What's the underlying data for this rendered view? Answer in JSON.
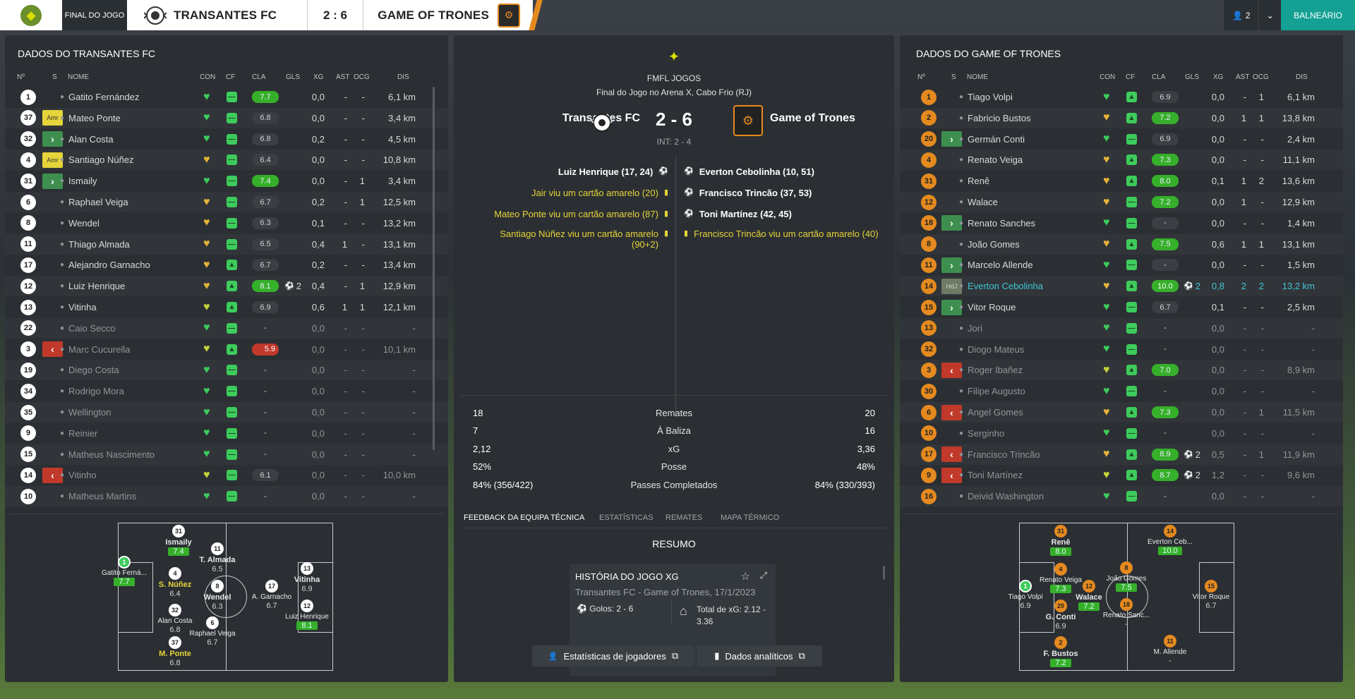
{
  "top": {
    "phase": "FINAL DO JOGO",
    "home": "TRANSANTES FC",
    "score": "2 : 6",
    "away": "GAME OF TRONES",
    "count": "2",
    "balneario": "BALNEÁRIO"
  },
  "headers": {
    "no": "Nº",
    "s": "S",
    "nome": "NOME",
    "con": "CON",
    "cf": "CF",
    "cla": "CLA",
    "gls": "GLS",
    "xg": "XG",
    "ast": "AST",
    "ocg": "OCG",
    "dis": "DIS"
  },
  "home": {
    "title": "DADOS DO TRANSANTES FC",
    "players": [
      {
        "no": "1",
        "s": "",
        "name": "Gatito Fernández",
        "con": "g",
        "cf": "-",
        "cla": "7.7",
        "clac": "g",
        "gls": "",
        "xg": "0,0",
        "ast": "-",
        "ocg": "-",
        "dis": "6,1 km",
        "dim": false
      },
      {
        "no": "37",
        "s": "Amr",
        "name": "Mateo Ponte",
        "con": "g",
        "cf": "-",
        "cla": "6.8",
        "clac": "n",
        "gls": "",
        "xg": "0,0",
        "ast": "-",
        "ocg": "-",
        "dis": "3,4 km",
        "dim": false
      },
      {
        "no": "32",
        "s": ">",
        "name": "Alan Costa",
        "con": "g",
        "cf": "-",
        "cla": "6.8",
        "clac": "n",
        "gls": "",
        "xg": "0,2",
        "ast": "-",
        "ocg": "-",
        "dis": "4,5 km",
        "dim": false
      },
      {
        "no": "4",
        "s": "Amr",
        "name": "Santiago Núñez",
        "con": "o",
        "cf": "-",
        "cla": "6.4",
        "clac": "n",
        "gls": "",
        "xg": "0,0",
        "ast": "-",
        "ocg": "-",
        "dis": "10,8 km",
        "dim": false
      },
      {
        "no": "31",
        "s": ">",
        "name": "Ismaily",
        "con": "g",
        "cf": "-",
        "cla": "7.4",
        "clac": "g",
        "gls": "",
        "xg": "0,0",
        "ast": "-",
        "ocg": "1",
        "dis": "3,4 km",
        "dim": false
      },
      {
        "no": "6",
        "s": "",
        "name": "Raphael Veiga",
        "con": "o",
        "cf": "-",
        "cla": "6.7",
        "clac": "n",
        "gls": "",
        "xg": "0,2",
        "ast": "-",
        "ocg": "1",
        "dis": "12,5 km",
        "dim": false
      },
      {
        "no": "8",
        "s": "",
        "name": "Wendel",
        "con": "o",
        "cf": "-",
        "cla": "6.3",
        "clac": "n",
        "gls": "",
        "xg": "0,1",
        "ast": "-",
        "ocg": "-",
        "dis": "13,2 km",
        "dim": false
      },
      {
        "no": "11",
        "s": "",
        "name": "Thiago Almada",
        "con": "o",
        "cf": "-",
        "cla": "6.5",
        "clac": "n",
        "gls": "",
        "xg": "0,4",
        "ast": "1",
        "ocg": "-",
        "dis": "13,1 km",
        "dim": false
      },
      {
        "no": "17",
        "s": "",
        "name": "Alejandro Garnacho",
        "con": "o",
        "cf": "+",
        "cla": "6.7",
        "clac": "n",
        "gls": "",
        "xg": "0,2",
        "ast": "-",
        "ocg": "-",
        "dis": "13,4 km",
        "dim": false
      },
      {
        "no": "12",
        "s": "",
        "name": "Luiz Henrique",
        "con": "o",
        "cf": "+",
        "cla": "8.1",
        "clac": "g",
        "gls": "2",
        "xg": "0,4",
        "ast": "-",
        "ocg": "1",
        "dis": "12,9 km",
        "dim": false
      },
      {
        "no": "13",
        "s": "",
        "name": "Vitinha",
        "con": "y",
        "cf": "+",
        "cla": "6.9",
        "clac": "n",
        "gls": "",
        "xg": "0,6",
        "ast": "1",
        "ocg": "1",
        "dis": "12,1 km",
        "dim": false
      },
      {
        "no": "22",
        "s": "",
        "name": "Caio Secco",
        "con": "g",
        "cf": "-",
        "cla": "-",
        "clac": "x",
        "gls": "",
        "xg": "0,0",
        "ast": "-",
        "ocg": "-",
        "dis": "-",
        "dim": true
      },
      {
        "no": "3",
        "s": "<",
        "name": "Marc Cucurella",
        "con": "y",
        "cf": "+",
        "cla": "5.9",
        "clac": "r",
        "gls": "",
        "xg": "0,0",
        "ast": "-",
        "ocg": "-",
        "dis": "10,1 km",
        "dim": true
      },
      {
        "no": "19",
        "s": "",
        "name": "Diego Costa",
        "con": "g",
        "cf": "-",
        "cla": "-",
        "clac": "x",
        "gls": "",
        "xg": "0,0",
        "ast": "-",
        "ocg": "-",
        "dis": "-",
        "dim": true
      },
      {
        "no": "34",
        "s": "",
        "name": "Rodrigo Mora",
        "con": "g",
        "cf": "-",
        "cla": "-",
        "clac": "x",
        "gls": "",
        "xg": "0,0",
        "ast": "-",
        "ocg": "-",
        "dis": "-",
        "dim": true
      },
      {
        "no": "35",
        "s": "",
        "name": "Wellington",
        "con": "g",
        "cf": "-",
        "cla": "-",
        "clac": "x",
        "gls": "",
        "xg": "0,0",
        "ast": "-",
        "ocg": "-",
        "dis": "-",
        "dim": true
      },
      {
        "no": "9",
        "s": "",
        "name": "Reinier",
        "con": "g",
        "cf": "-",
        "cla": "-",
        "clac": "x",
        "gls": "",
        "xg": "0,0",
        "ast": "-",
        "ocg": "-",
        "dis": "-",
        "dim": true
      },
      {
        "no": "15",
        "s": "",
        "name": "Matheus Nascimento",
        "con": "g",
        "cf": "-",
        "cla": "-",
        "clac": "x",
        "gls": "",
        "xg": "0,0",
        "ast": "-",
        "ocg": "-",
        "dis": "-",
        "dim": true
      },
      {
        "no": "14",
        "s": "<",
        "name": "Vitinho",
        "con": "y",
        "cf": "-",
        "cla": "6.1",
        "clac": "n",
        "gls": "",
        "xg": "0,0",
        "ast": "-",
        "ocg": "-",
        "dis": "10,0 km",
        "dim": true
      },
      {
        "no": "10",
        "s": "",
        "name": "Matheus Martins",
        "con": "g",
        "cf": "-",
        "cla": "-",
        "clac": "x",
        "gls": "",
        "xg": "0,0",
        "ast": "-",
        "ocg": "-",
        "dis": "-",
        "dim": true
      }
    ],
    "formation": [
      {
        "no": "1",
        "name": "Gatito Ferná...",
        "rating": "7.7",
        "g": true,
        "gk": true,
        "y": false,
        "b": false
      },
      {
        "no": "31",
        "name": "Ismaily",
        "rating": "7.4",
        "g": true,
        "gk": false,
        "y": false,
        "b": true
      },
      {
        "no": "4",
        "name": "S. Núñez",
        "rating": "6.4",
        "g": false,
        "gk": false,
        "y": true,
        "b": true
      },
      {
        "no": "32",
        "name": "Alan Costa",
        "rating": "6.8",
        "g": false,
        "gk": false,
        "y": false,
        "b": false
      },
      {
        "no": "37",
        "name": "M. Ponte",
        "rating": "6.8",
        "g": false,
        "gk": false,
        "y": true,
        "b": true
      },
      {
        "no": "11",
        "name": "T. Almada",
        "rating": "6.5",
        "g": false,
        "gk": false,
        "y": false,
        "b": true
      },
      {
        "no": "8",
        "name": "Wendel",
        "rating": "6.3",
        "g": false,
        "gk": false,
        "y": false,
        "b": true
      },
      {
        "no": "6",
        "name": "Raphael Veiga",
        "rating": "6.7",
        "g": false,
        "gk": false,
        "y": false,
        "b": false
      },
      {
        "no": "17",
        "name": "A. Garnacho",
        "rating": "6.7",
        "g": false,
        "gk": false,
        "y": false,
        "b": false
      },
      {
        "no": "13",
        "name": "Vitinha",
        "rating": "6.9",
        "g": false,
        "gk": false,
        "y": false,
        "b": true
      },
      {
        "no": "12",
        "name": "Luiz Henrique",
        "rating": "8.1",
        "g": true,
        "gk": false,
        "y": false,
        "b": false
      }
    ]
  },
  "away": {
    "title": "DADOS DO GAME OF TRONES",
    "players": [
      {
        "no": "1",
        "s": "",
        "name": "Tiago Volpi",
        "con": "g",
        "cf": "+",
        "cla": "6.9",
        "clac": "n",
        "gls": "",
        "xg": "0,0",
        "ast": "-",
        "ocg": "1",
        "dis": "6,1 km",
        "dim": false
      },
      {
        "no": "2",
        "s": "",
        "name": "Fabricio Bustos",
        "con": "o",
        "cf": "+",
        "cla": "7.2",
        "clac": "g",
        "gls": "",
        "xg": "0,0",
        "ast": "1",
        "ocg": "1",
        "dis": "13,8 km",
        "dim": false
      },
      {
        "no": "20",
        "s": ">",
        "name": "Germán Conti",
        "con": "g",
        "cf": "-",
        "cla": "6.9",
        "clac": "n",
        "gls": "",
        "xg": "0,0",
        "ast": "-",
        "ocg": "-",
        "dis": "2,4 km",
        "dim": false
      },
      {
        "no": "4",
        "s": "",
        "name": "Renato Veiga",
        "con": "o",
        "cf": "+",
        "cla": "7.3",
        "clac": "g",
        "gls": "",
        "xg": "0,0",
        "ast": "-",
        "ocg": "-",
        "dis": "11,1 km",
        "dim": false
      },
      {
        "no": "31",
        "s": "",
        "name": "Renê",
        "con": "o",
        "cf": "+",
        "cla": "8.0",
        "clac": "g",
        "gls": "",
        "xg": "0,1",
        "ast": "1",
        "ocg": "2",
        "dis": "13,6 km",
        "dim": false
      },
      {
        "no": "12",
        "s": "",
        "name": "Walace",
        "con": "o",
        "cf": "-",
        "cla": "7.2",
        "clac": "g",
        "gls": "",
        "xg": "0,0",
        "ast": "1",
        "ocg": "-",
        "dis": "12,9 km",
        "dim": false
      },
      {
        "no": "18",
        "s": ">",
        "name": "Renato Sanches",
        "con": "g",
        "cf": "-",
        "cla": "-",
        "clac": "n",
        "gls": "",
        "xg": "0,0",
        "ast": "-",
        "ocg": "-",
        "dis": "1,4 km",
        "dim": false
      },
      {
        "no": "8",
        "s": "",
        "name": "João Gomes",
        "con": "o",
        "cf": "+",
        "cla": "7.5",
        "clac": "g",
        "gls": "",
        "xg": "0,6",
        "ast": "1",
        "ocg": "1",
        "dis": "13,1 km",
        "dim": false
      },
      {
        "no": "11",
        "s": ">",
        "name": "Marcelo Allende",
        "con": "g",
        "cf": "-",
        "cla": "-",
        "clac": "n",
        "gls": "",
        "xg": "0,0",
        "ast": "-",
        "ocg": "-",
        "dis": "1,5 km",
        "dim": false
      },
      {
        "no": "14",
        "s": "HdJ",
        "name": "Everton Cebolinha",
        "con": "o",
        "cf": "+",
        "cla": "10.0",
        "clac": "g",
        "gls": "2",
        "xg": "0,8",
        "ast": "2",
        "ocg": "2",
        "dis": "13,2 km",
        "dim": false,
        "hl": true
      },
      {
        "no": "15",
        "s": ">",
        "name": "Vitor Roque",
        "con": "g",
        "cf": "-",
        "cla": "6.7",
        "clac": "n",
        "gls": "",
        "xg": "0,1",
        "ast": "-",
        "ocg": "-",
        "dis": "2,5 km",
        "dim": false
      },
      {
        "no": "13",
        "s": "",
        "name": "Jori",
        "con": "g",
        "cf": "-",
        "cla": "-",
        "clac": "x",
        "gls": "",
        "xg": "0,0",
        "ast": "-",
        "ocg": "-",
        "dis": "-",
        "dim": true
      },
      {
        "no": "32",
        "s": "",
        "name": "Diogo Mateus",
        "con": "g",
        "cf": "-",
        "cla": "-",
        "clac": "x",
        "gls": "",
        "xg": "0,0",
        "ast": "-",
        "ocg": "-",
        "dis": "-",
        "dim": true
      },
      {
        "no": "3",
        "s": "<",
        "name": "Roger Ibañez",
        "con": "y",
        "cf": "+",
        "cla": "7.0",
        "clac": "g",
        "gls": "",
        "xg": "0,0",
        "ast": "-",
        "ocg": "-",
        "dis": "8,9 km",
        "dim": true
      },
      {
        "no": "30",
        "s": "",
        "name": "Filipe Augusto",
        "con": "g",
        "cf": "-",
        "cla": "-",
        "clac": "x",
        "gls": "",
        "xg": "0,0",
        "ast": "-",
        "ocg": "-",
        "dis": "-",
        "dim": true
      },
      {
        "no": "6",
        "s": "<",
        "name": "Angel Gomes",
        "con": "o",
        "cf": "+",
        "cla": "7.3",
        "clac": "g",
        "gls": "",
        "xg": "0,0",
        "ast": "-",
        "ocg": "1",
        "dis": "11,5 km",
        "dim": true
      },
      {
        "no": "10",
        "s": "",
        "name": "Serginho",
        "con": "g",
        "cf": "-",
        "cla": "-",
        "clac": "x",
        "gls": "",
        "xg": "0,0",
        "ast": "-",
        "ocg": "-",
        "dis": "-",
        "dim": true
      },
      {
        "no": "17",
        "s": "<",
        "name": "Francisco Trincão",
        "con": "o",
        "cf": "+",
        "cla": "8.9",
        "clac": "g",
        "gls": "2",
        "xg": "0,5",
        "ast": "-",
        "ocg": "1",
        "dis": "11,9 km",
        "dim": true
      },
      {
        "no": "9",
        "s": "<",
        "name": "Toni Martínez",
        "con": "y",
        "cf": "+",
        "cla": "8.7",
        "clac": "g",
        "gls": "2",
        "xg": "1,2",
        "ast": "-",
        "ocg": "-",
        "dis": "9,6 km",
        "dim": true
      },
      {
        "no": "16",
        "s": "",
        "name": "Deivid Washington",
        "con": "g",
        "cf": "-",
        "cla": "-",
        "clac": "x",
        "gls": "",
        "xg": "0,0",
        "ast": "-",
        "ocg": "-",
        "dis": "-",
        "dim": true
      }
    ],
    "formation": [
      {
        "no": "1",
        "name": "Tiago Volpi",
        "rating": "6.9",
        "g": false,
        "gk": true
      },
      {
        "no": "31",
        "name": "Renê",
        "rating": "8.0",
        "g": true,
        "gk": false,
        "b": true
      },
      {
        "no": "4",
        "name": "Renato Veiga",
        "rating": "7.3",
        "g": true,
        "gk": false
      },
      {
        "no": "20",
        "name": "G. Conti",
        "rating": "6.9",
        "g": false,
        "gk": false,
        "b": true
      },
      {
        "no": "2",
        "name": "F. Bustos",
        "rating": "7.2",
        "g": true,
        "gk": false,
        "b": true
      },
      {
        "no": "12",
        "name": "Walace",
        "rating": "7.2",
        "g": true,
        "gk": false,
        "b": true
      },
      {
        "no": "8",
        "name": "João Gomes",
        "rating": "7.5",
        "g": true,
        "gk": false
      },
      {
        "no": "18",
        "name": "Renato Sanc...",
        "rating": "-",
        "g": false,
        "gk": false
      },
      {
        "no": "14",
        "name": "Everton Ceb...",
        "rating": "10.0",
        "g": true,
        "gk": false
      },
      {
        "no": "15",
        "name": "Vitor Roque",
        "rating": "6.7",
        "g": false,
        "gk": false
      },
      {
        "no": "11",
        "name": "M. Allende",
        "rating": "-",
        "g": false,
        "gk": false
      }
    ]
  },
  "center": {
    "competition": "FMFL JOGOS",
    "venue": "Final do Jogo no Arena X, Cabo Frio (RJ)",
    "home": "Transantes FC",
    "away": "Game of Trones",
    "score": "2 - 6",
    "ht": "INT: 2 - 4",
    "home_events": [
      {
        "text": "Luiz Henrique (17, 24)",
        "type": "goal"
      },
      {
        "text": "Jair viu um cartão amarelo (20)",
        "type": "card"
      },
      {
        "text": "Mateo Ponte viu um cartão amarelo (87)",
        "type": "card"
      },
      {
        "text": "Santiago Núñez viu um cartão amarelo (90+2)",
        "type": "card"
      }
    ],
    "away_events": [
      {
        "text": "Everton Cebolinha (10, 51)",
        "type": "goal"
      },
      {
        "text": "Francisco Trincão (37, 53)",
        "type": "goal"
      },
      {
        "text": "Toni Martínez (42, 45)",
        "type": "goal"
      },
      {
        "text": "Francisco Trincão viu um cartão amarelo (40)",
        "type": "card"
      }
    ],
    "stats": [
      {
        "home": "18",
        "label": "Remates",
        "away": "20"
      },
      {
        "home": "7",
        "label": "À Baliza",
        "away": "16"
      },
      {
        "home": "2,12",
        "label": "xG",
        "away": "3,36"
      },
      {
        "home": "52%",
        "label": "Posse",
        "away": "48%"
      },
      {
        "home": "84% (356/422)",
        "label": "Passes Completados",
        "away": "84% (330/393)"
      }
    ],
    "tabs": [
      "FEEDBACK DA EQUIPA TÉCNICA",
      "ESTATÍSTICAS",
      "REMATES",
      "MAPA TÉRMICO"
    ],
    "resumo": "RESUMO",
    "card_title": "HISTÓRIA DO JOGO XG",
    "card_sub": "Transantes FC - Game of Trones, 17/1/2023",
    "card_goals": "Golos: 2 - 6",
    "card_xg": "Total de xG: 2.12 - 3.36",
    "btn_players": "Estatísticas de jogadores",
    "btn_analytics": "Dados analíticos"
  },
  "colors": {
    "accent": "#14a093",
    "orange": "#e58a1f",
    "green": "#36b02a",
    "red": "#c0392b",
    "yellow": "#e5d43a"
  }
}
